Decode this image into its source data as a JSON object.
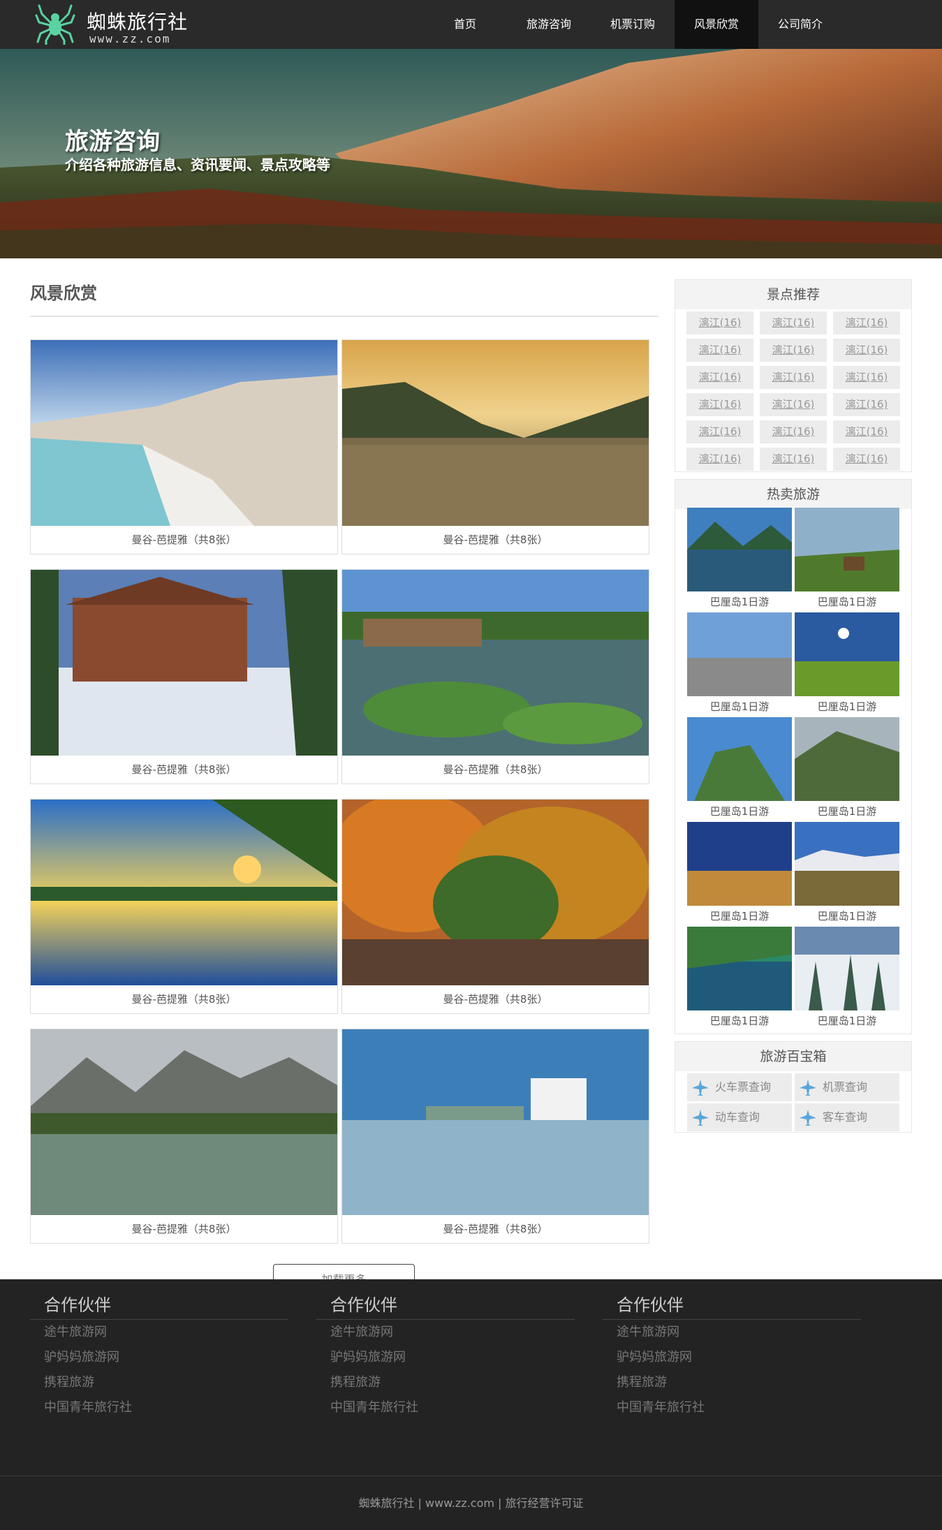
{
  "header": {
    "title": "蜘蛛旅行社",
    "subtitle": "www.zz.com",
    "nav": [
      "首页",
      "旅游咨询",
      "机票订购",
      "风景欣赏",
      "公司简介"
    ],
    "active_nav": "风景欣赏"
  },
  "banner": {
    "title": "旅游咨询",
    "subtitle": "介绍各种旅游信息、资讯要闻、景点攻略等"
  },
  "gallery": {
    "title": "风景欣赏",
    "items": [
      {
        "caption": "曼谷-芭提雅（共8张）"
      },
      {
        "caption": "曼谷-芭提雅（共8张）"
      },
      {
        "caption": "曼谷-芭提雅（共8张）"
      },
      {
        "caption": "曼谷-芭提雅（共8张）"
      },
      {
        "caption": "曼谷-芭提雅（共8张）"
      },
      {
        "caption": "曼谷-芭提雅（共8张）"
      },
      {
        "caption": "曼谷-芭提雅（共8张）"
      },
      {
        "caption": "曼谷-芭提雅（共8张）"
      }
    ],
    "load_more": "加载更多"
  },
  "sidebar": {
    "recommend": {
      "title": "景点推荐",
      "tags": [
        "漓江(16)",
        "漓江(16)",
        "漓江(16)",
        "漓江(16)",
        "漓江(16)",
        "漓江(16)",
        "漓江(16)",
        "漓江(16)",
        "漓江(16)",
        "漓江(16)",
        "漓江(16)",
        "漓江(16)",
        "漓江(16)",
        "漓江(16)",
        "漓江(16)",
        "漓江(16)",
        "漓江(16)",
        "漓江(16)"
      ]
    },
    "hot": {
      "title": "热卖旅游",
      "items": [
        "巴厘岛1日游",
        "巴厘岛1日游",
        "巴厘岛1日游",
        "巴厘岛1日游",
        "巴厘岛1日游",
        "巴厘岛1日游",
        "巴厘岛1日游",
        "巴厘岛1日游",
        "巴厘岛1日游",
        "巴厘岛1日游"
      ]
    },
    "tools": {
      "title": "旅游百宝箱",
      "items": [
        "火车票查询",
        "机票查询",
        "动车查询",
        "客车查询"
      ],
      "icon": "airplane-icon"
    }
  },
  "footer": {
    "columns": [
      {
        "title": "合作伙伴",
        "links": [
          "途牛旅游网",
          "驴妈妈旅游网",
          "携程旅游",
          "中国青年旅行社"
        ]
      },
      {
        "title": "合作伙伴",
        "links": [
          "途牛旅游网",
          "驴妈妈旅游网",
          "携程旅游",
          "中国青年旅行社"
        ]
      },
      {
        "title": "合作伙伴",
        "links": [
          "途牛旅游网",
          "驴妈妈旅游网",
          "携程旅游",
          "中国青年旅行社"
        ]
      }
    ],
    "copyright": "蜘蛛旅行社 | www.zz.com | 旅行经营许可证"
  }
}
